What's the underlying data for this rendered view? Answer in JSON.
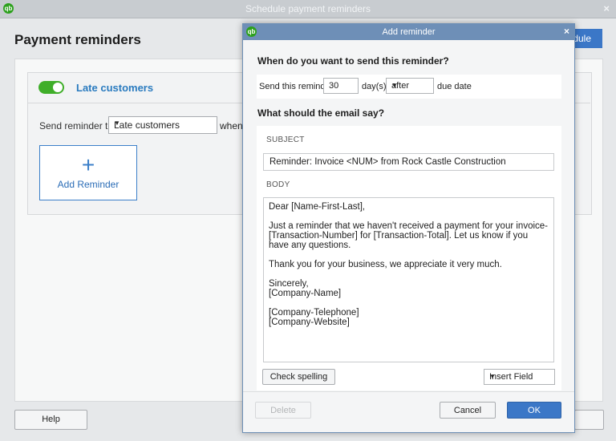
{
  "bg": {
    "window_title": "Schedule payment reminders",
    "heading": "Payment reminders",
    "schedule_label": "dule",
    "group_name": "Late customers",
    "send_to_label": "Send reminder to",
    "send_to_value": "Late customers",
    "when_label": "when",
    "add_reminder_label": "Add Reminder",
    "help_label": "Help"
  },
  "dialog": {
    "title": "Add reminder",
    "q_when": "When do you want to send this reminder?",
    "send_label": "Send this reminder",
    "days_value": "30",
    "days_unit": "day(s)",
    "relation": "after",
    "due_label": "due date",
    "q_email": "What should the email say?",
    "subject_caption": "SUBJECT",
    "subject_value": "Reminder: Invoice <NUM> from Rock Castle Construction",
    "body_caption": "BODY",
    "body": {
      "p1": "Dear [Name-First-Last],",
      "p2": "Just a reminder that we haven't received a payment for your invoice-[Transaction-Number] for [Transaction-Total]. Let us know if you have any questions.",
      "p3": "Thank you for your business, we appreciate it very much.",
      "p4a": "Sincerely,",
      "p4b": "[Company-Name]",
      "p5a": "[Company-Telephone]",
      "p5b": "[Company-Website]"
    },
    "check_spelling": "Check spelling",
    "insert_field": "Insert Field",
    "delete": "Delete",
    "cancel": "Cancel",
    "ok": "OK"
  },
  "colors": {
    "accent": "#3b77c7",
    "toggle_on": "#3fae29",
    "dialog_title": "#6e8fb7"
  }
}
